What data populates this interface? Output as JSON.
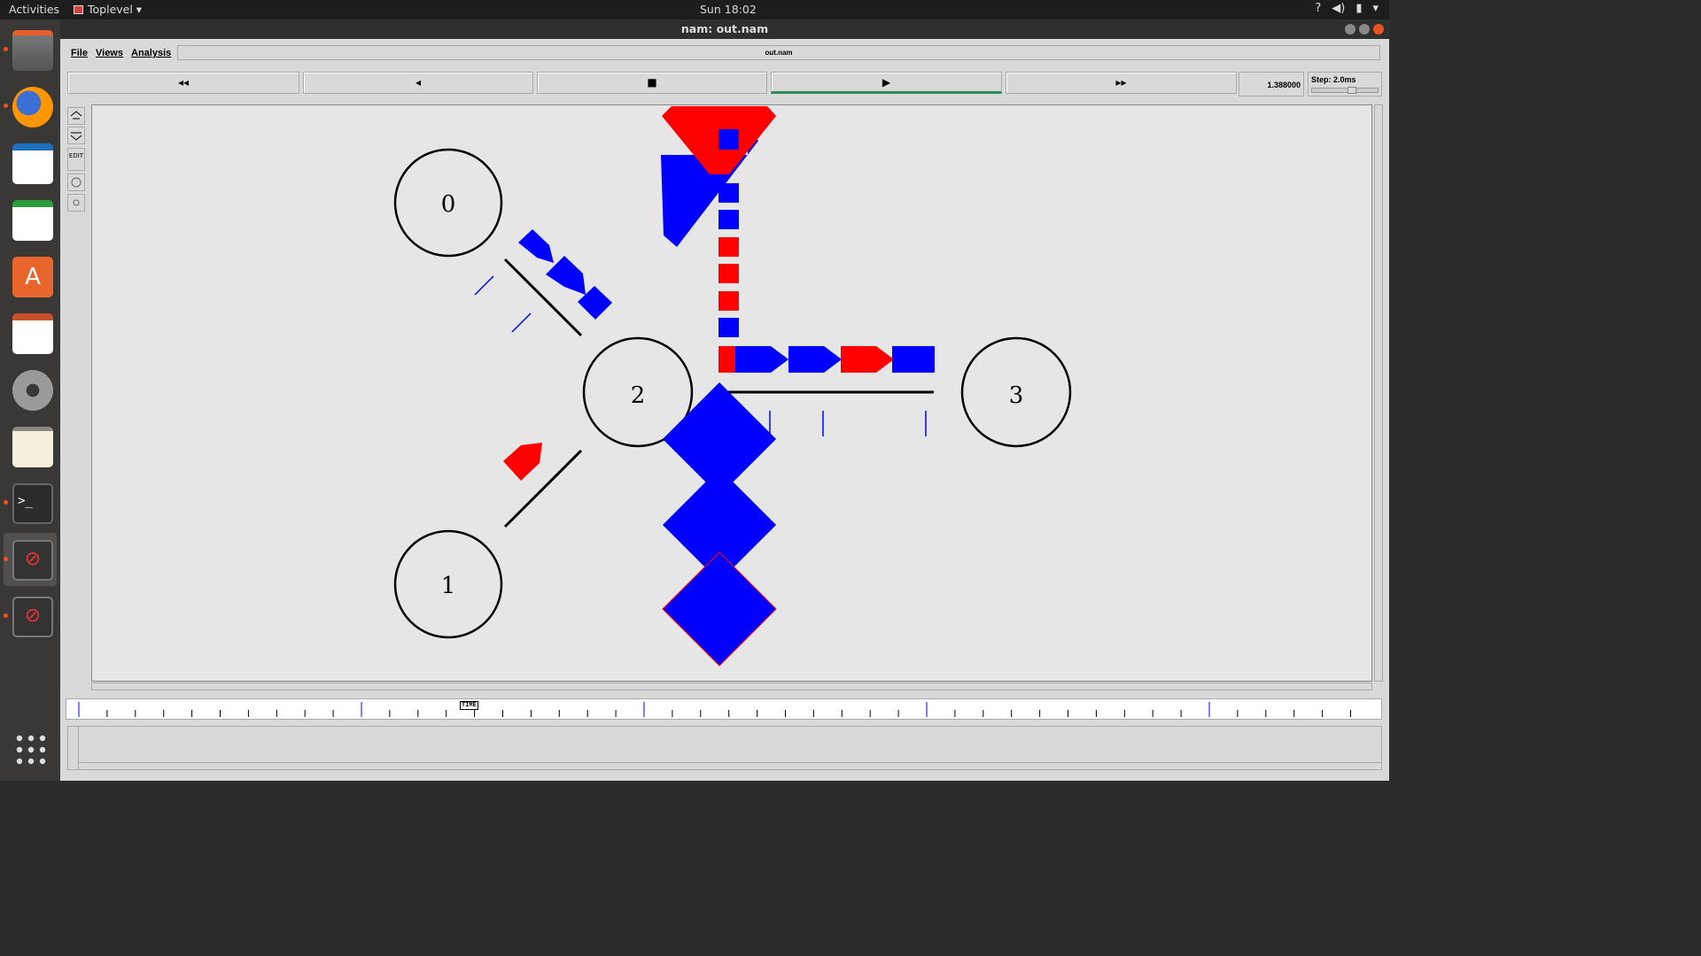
{
  "topbar": {
    "activities": "Activities",
    "app_menu": "Toplevel ▾",
    "clock": "Sun 18:02",
    "status_icons": [
      "help-icon",
      "volume-icon",
      "battery-icon",
      "dropdown-icon"
    ]
  },
  "dock": {
    "apps": [
      {
        "name": "files",
        "icon": "files-icon",
        "running": true
      },
      {
        "name": "firefox",
        "icon": "firefox-icon",
        "running": true
      },
      {
        "name": "libreoffice-impress-draw",
        "icon": "document-icon",
        "running": false
      },
      {
        "name": "libreoffice-calc",
        "icon": "spreadsheet-icon",
        "running": false
      },
      {
        "name": "software",
        "icon": "store-icon",
        "running": false
      },
      {
        "name": "libreoffice-impress",
        "icon": "presentation-icon",
        "running": false
      },
      {
        "name": "settings",
        "icon": "settings-icon",
        "running": false
      },
      {
        "name": "text-editor",
        "icon": "text-editor-icon",
        "running": false
      },
      {
        "name": "terminal",
        "icon": "terminal-icon",
        "running": true
      },
      {
        "name": "nam-window-1",
        "icon": "blocked-window-icon",
        "running": true
      },
      {
        "name": "nam-window-2",
        "icon": "blocked-window-icon",
        "running": true
      }
    ],
    "show_apps_icon": "grid-icon"
  },
  "window": {
    "title": "nam: out.nam",
    "menus": [
      "File",
      "Views",
      "Analysis"
    ],
    "filename": "out.nam",
    "controls": {
      "rewind": "◂◂",
      "back": "◂",
      "stop": "■",
      "play": "▶",
      "fast_forward": "▸▸",
      "active": "play"
    },
    "current_time": "1.388000",
    "step": "Step: 2.0ms",
    "tools": [
      "zoom-in-icon",
      "zoom-out-icon",
      "EDIT",
      "circle-icon",
      "small-circle-icon"
    ]
  },
  "network": {
    "nodes": [
      {
        "id": "0",
        "label": "0"
      },
      {
        "id": "1",
        "label": "1"
      },
      {
        "id": "2",
        "label": "2"
      },
      {
        "id": "3",
        "label": "3"
      }
    ],
    "links": [
      {
        "from": "0",
        "to": "2"
      },
      {
        "from": "1",
        "to": "2"
      },
      {
        "from": "2",
        "to": "3"
      }
    ],
    "colors": {
      "blue_flow": "#0000ff",
      "red_flow": "#ff0000",
      "node_stroke": "#000000",
      "canvas_bg": "#e6e6e6"
    }
  },
  "timeline": {
    "marker_label": "TIME"
  }
}
